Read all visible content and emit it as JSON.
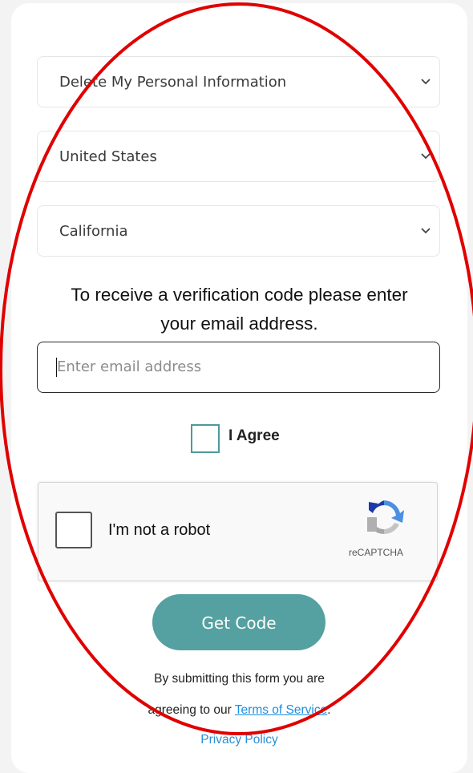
{
  "selects": [
    {
      "label": "Delete My Personal Information"
    },
    {
      "label": "United States"
    },
    {
      "label": "California"
    }
  ],
  "prompt": {
    "line1": "To receive a verification code please enter",
    "line2": "your email address."
  },
  "email": {
    "placeholder": "Enter email address",
    "value": ""
  },
  "agree": {
    "label": "I Agree",
    "checked": false
  },
  "captcha": {
    "label": "I'm not a robot",
    "brand": "reCAPTCHA",
    "checked": false
  },
  "submit": {
    "label": "Get Code"
  },
  "legal": {
    "line1": "By submitting this form you are",
    "line2_prefix": "agreeing to our ",
    "terms_link": "Terms of Service",
    "line2_suffix": ".",
    "privacy_link": "Privacy Policy"
  },
  "colors": {
    "accent": "#55a0a1",
    "link": "#1a8fe3",
    "annotation": "#e00000"
  }
}
